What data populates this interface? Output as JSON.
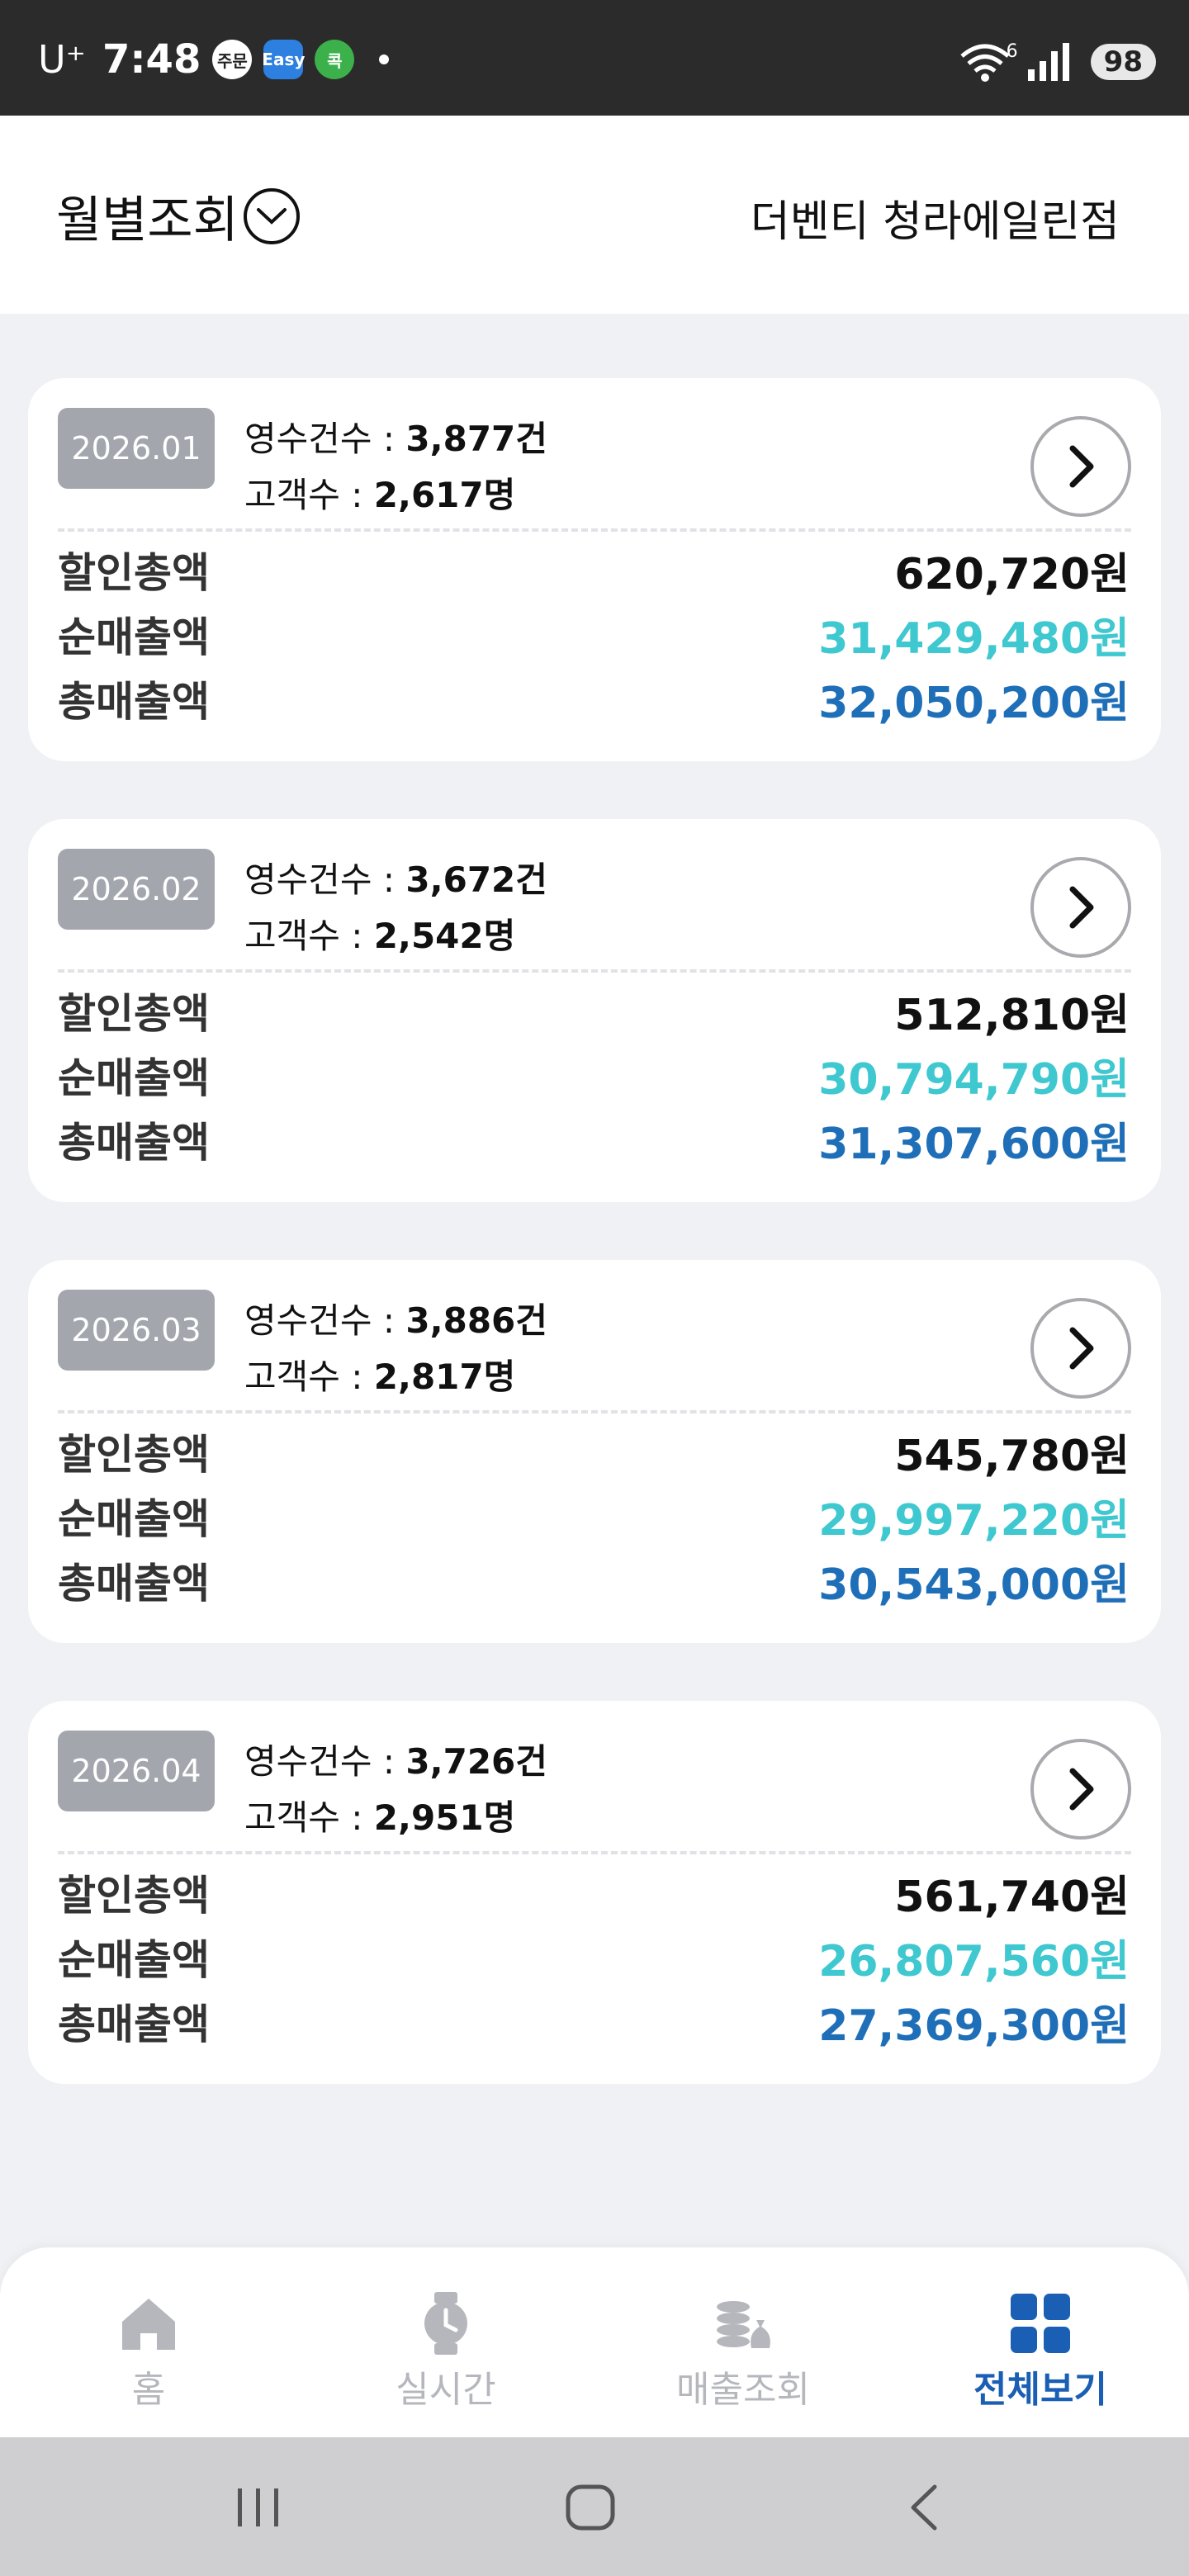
{
  "status_bar": {
    "carrier": "U⁺",
    "time": "7:48",
    "app_icons": [
      "주문",
      "Easy",
      "콕"
    ],
    "battery": "98",
    "wifi_badge": "6"
  },
  "header": {
    "title": "월별조회",
    "store_name": "더벤티 청라에일린점"
  },
  "labels": {
    "receipts_label": "영수건수 : ",
    "customers_label": "고객수 : ",
    "discount_label": "할인총액",
    "net_label": "순매출액",
    "gross_label": "총매출액"
  },
  "cards": [
    {
      "month": "2026.01",
      "receipts": "3,877건",
      "customers": "2,617명",
      "discount": "620,720원",
      "net": "31,429,480원",
      "gross": "32,050,200원"
    },
    {
      "month": "2026.02",
      "receipts": "3,672건",
      "customers": "2,542명",
      "discount": "512,810원",
      "net": "30,794,790원",
      "gross": "31,307,600원"
    },
    {
      "month": "2026.03",
      "receipts": "3,886건",
      "customers": "2,817명",
      "discount": "545,780원",
      "net": "29,997,220원",
      "gross": "30,543,000원"
    },
    {
      "month": "2026.04",
      "receipts": "3,726건",
      "customers": "2,951명",
      "discount": "561,740원",
      "net": "26,807,560원",
      "gross": "27,369,300원"
    }
  ],
  "bottom_nav": {
    "tabs": [
      {
        "label": "홈",
        "icon": "home-icon",
        "active": false
      },
      {
        "label": "실시간",
        "icon": "watch-icon",
        "active": false
      },
      {
        "label": "매출조회",
        "icon": "coins-icon",
        "active": false
      },
      {
        "label": "전체보기",
        "icon": "grid-icon",
        "active": true
      }
    ]
  },
  "colors": {
    "net_sales": "#3fc8cf",
    "gross_sales": "#1f6fb8",
    "active_tab": "#1a5fb4",
    "badge_bg": "#a3a6ad"
  }
}
